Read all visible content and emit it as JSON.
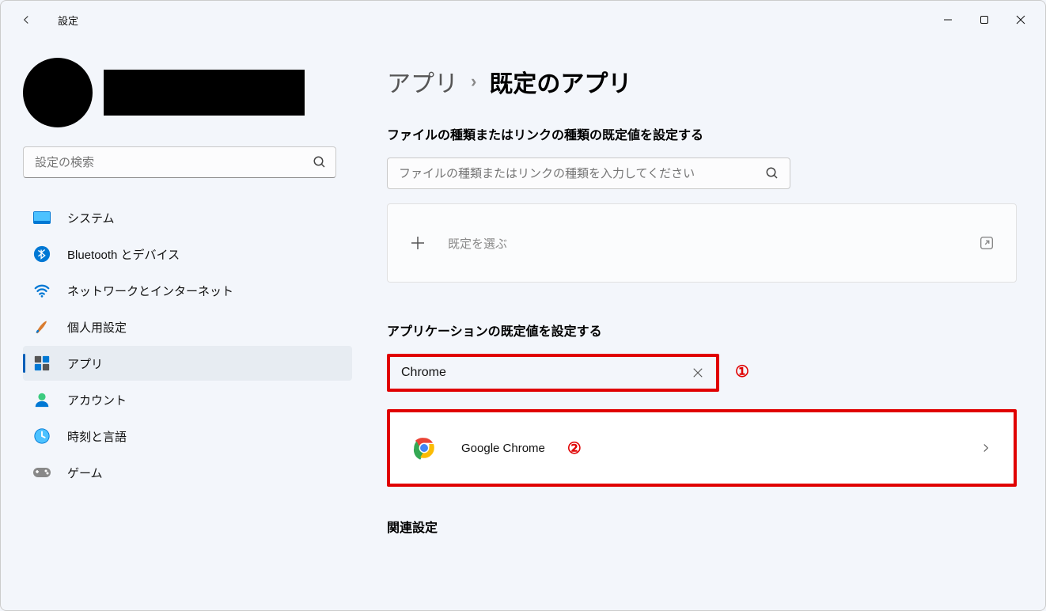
{
  "window": {
    "title": "設定"
  },
  "sidebar": {
    "search_placeholder": "設定の検索",
    "items": [
      {
        "label": "システム"
      },
      {
        "label": "Bluetooth とデバイス"
      },
      {
        "label": "ネットワークとインターネット"
      },
      {
        "label": "個人用設定"
      },
      {
        "label": "アプリ"
      },
      {
        "label": "アカウント"
      },
      {
        "label": "時刻と言語"
      },
      {
        "label": "ゲーム"
      }
    ]
  },
  "breadcrumb": {
    "parent": "アプリ",
    "current": "既定のアプリ"
  },
  "main": {
    "filetype_section_title": "ファイルの種類またはリンクの種類の既定値を設定する",
    "filetype_search_placeholder": "ファイルの種類またはリンクの種類を入力してください",
    "choose_default_label": "既定を選ぶ",
    "app_section_title": "アプリケーションの既定値を設定する",
    "app_search_value": "Chrome",
    "result_app_name": "Google Chrome",
    "related_title": "関連設定"
  },
  "annotations": {
    "one": "①",
    "two": "②"
  }
}
